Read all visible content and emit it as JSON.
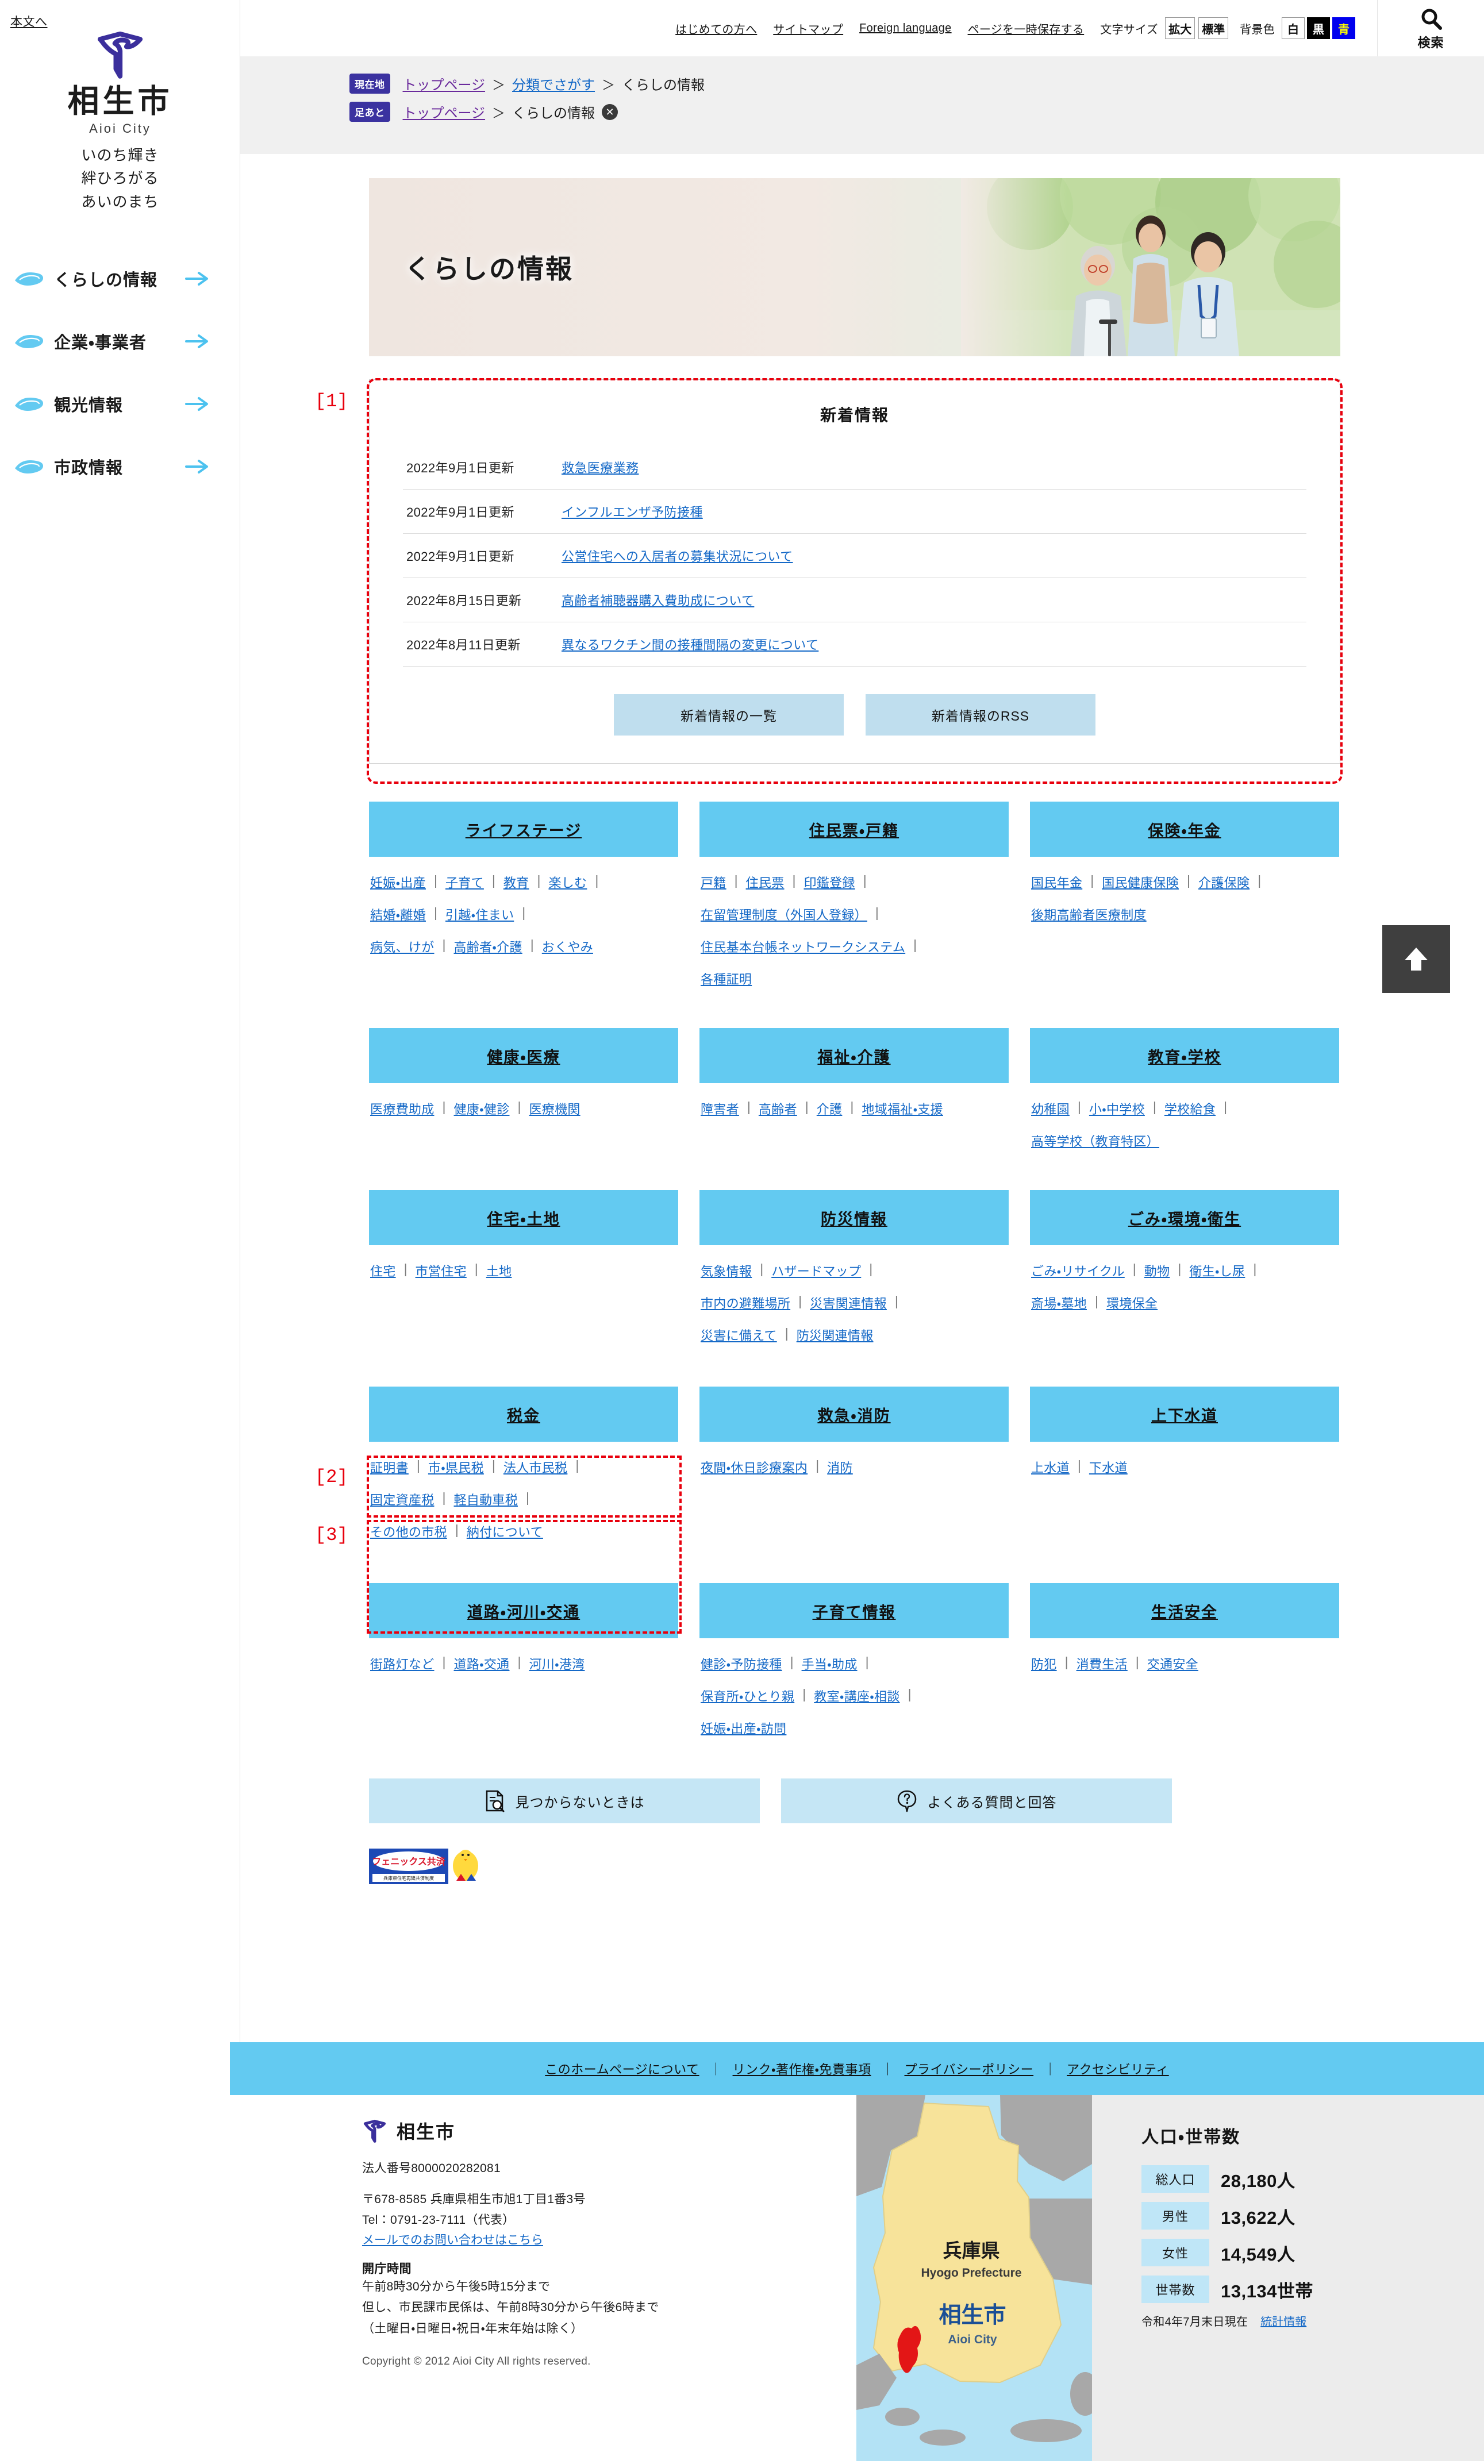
{
  "skip_link": "本文へ",
  "brand": {
    "name_jp": "相生市",
    "name_en": "Aioi City",
    "slogan": [
      "いのち輝き",
      "絆ひろがる",
      "あいのまち"
    ]
  },
  "utility": {
    "links": [
      "はじめての方へ",
      "サイトマップ",
      "Foreign language",
      "ページを一時保存する"
    ],
    "text_size_label": "文字サイズ",
    "text_size_options": [
      "拡大",
      "標準"
    ],
    "bg_color_label": "背景色",
    "bg_color_options": [
      "白",
      "黒",
      "青"
    ],
    "search_label": "検索"
  },
  "breadcrumbs": {
    "current_badge": "現在地",
    "current_items": [
      "トップページ",
      "分類でさがす",
      "くらしの情報"
    ],
    "history_badge": "足あと",
    "history_items": [
      "トップページ",
      "くらしの情報"
    ],
    "close": "✕",
    "separator": "＞"
  },
  "sidebar": {
    "items": [
      {
        "label": "くらしの情報"
      },
      {
        "label": "企業・事業者"
      },
      {
        "label": "観光情報"
      },
      {
        "label": "市政情報"
      }
    ]
  },
  "hero": {
    "title": "くらしの情報"
  },
  "news": {
    "heading": "新着情報",
    "items": [
      {
        "date": "2022年9月1日更新",
        "title": "救急医療業務"
      },
      {
        "date": "2022年9月1日更新",
        "title": "インフルエンザ予防接種"
      },
      {
        "date": "2022年9月1日更新",
        "title": "公営住宅への入居者の募集状況について"
      },
      {
        "date": "2022年8月15日更新",
        "title": "高齢者補聴器購入費助成について"
      },
      {
        "date": "2022年8月11日更新",
        "title": "異なるワクチン間の接種間隔の変更について"
      }
    ],
    "buttons": [
      "新着情報の一覧",
      "新着情報のRSS"
    ]
  },
  "categories": [
    {
      "title": "ライフステージ",
      "links": [
        "妊娠・出産",
        "子育て",
        "教育",
        "楽しむ",
        "結婚・離婚",
        "引越・住まい",
        "病気、けが",
        "高齢者・介護",
        "おくやみ"
      ]
    },
    {
      "title": "住民票・戸籍",
      "links": [
        "戸籍",
        "住民票",
        "印鑑登録",
        "在留管理制度（外国人登録）",
        "住民基本台帳ネットワークシステム",
        "各種証明"
      ]
    },
    {
      "title": "保険・年金",
      "links": [
        "国民年金",
        "国民健康保険",
        "介護保険",
        "後期高齢者医療制度"
      ]
    },
    {
      "title": "健康・医療",
      "links": [
        "医療費助成",
        "健康・健診",
        "医療機関"
      ]
    },
    {
      "title": "福祉・介護",
      "links": [
        "障害者",
        "高齢者",
        "介護",
        "地域福祉・支援"
      ]
    },
    {
      "title": "教育・学校",
      "links": [
        "幼稚園",
        "小・中学校",
        "学校給食",
        "高等学校（教育特区）"
      ]
    },
    {
      "title": "住宅・土地",
      "links": [
        "住宅",
        "市営住宅",
        "土地"
      ]
    },
    {
      "title": "防災情報",
      "links": [
        "気象情報",
        "ハザードマップ",
        "市内の避難場所",
        "災害関連情報",
        "災害に備えて",
        "防災関連情報"
      ]
    },
    {
      "title": "ごみ・環境・衛生",
      "links": [
        "ごみ・リサイクル",
        "動物",
        "衛生・し尿",
        "斎場・墓地",
        "環境保全"
      ]
    },
    {
      "title": "税金",
      "links": [
        "証明書",
        "市・県民税",
        "法人市民税",
        "固定資産税",
        "軽自動車税",
        "その他の市税",
        "納付について"
      ]
    },
    {
      "title": "救急・消防",
      "links": [
        "夜間・休日診療案内",
        "消防"
      ]
    },
    {
      "title": "上下水道",
      "links": [
        "上水道",
        "下水道"
      ]
    },
    {
      "title": "道路・河川・交通",
      "links": [
        "街路灯など",
        "道路・交通",
        "河川・港湾"
      ]
    },
    {
      "title": "子育て情報",
      "links": [
        "健診・予防接種",
        "手当・助成",
        "保育所・ひとり親",
        "教室・講座・相談",
        "妊娠・出産・訪問"
      ]
    },
    {
      "title": "生活安全",
      "links": [
        "防犯",
        "消費生活",
        "交通安全"
      ]
    }
  ],
  "help_buttons": [
    {
      "label": "見つからないときは",
      "icon": "document-search-icon"
    },
    {
      "label": "よくある質問と回答",
      "icon": "question-balloon-icon"
    }
  ],
  "phoenix_banner": {
    "title": "フェニックス共済",
    "subtitle": "兵庫県住宅再建共済制度"
  },
  "footer": {
    "links": [
      "このホームページについて",
      "リンク・著作権・免責事項",
      "プライバシーポリシー",
      "アクセシビリティ"
    ],
    "link_separator": "｜",
    "city": "相生市",
    "corporate_number": "法人番号8000020282081",
    "address": "〒678-8585 兵庫県相生市旭1丁目1番3号",
    "tel": "Tel：0791-23-7111（代表）",
    "mail_link": "メールでのお問い合わせはこちら",
    "hours_heading": "開庁時間",
    "hours_lines": [
      "午前8時30分から午後5時15分まで",
      "但し、市民課市民係は、午前8時30分から午後6時まで",
      "（土曜日・日曜日・祝日・年末年始は除く）"
    ],
    "copyright": "Copyright © 2012 Aioi City All rights reserved."
  },
  "map": {
    "prefecture_jp": "兵庫県",
    "prefecture_en": "Hyogo Prefecture",
    "city_jp": "相生市",
    "city_en": "Aioi City"
  },
  "stats": {
    "title": "人口・世帯数",
    "rows": [
      {
        "label": "総人口",
        "value": "28,180人"
      },
      {
        "label": "男性",
        "value": "13,622人"
      },
      {
        "label": "女性",
        "value": "14,549人"
      },
      {
        "label": "世帯数",
        "value": "13,134世帯"
      }
    ],
    "as_of": "令和4年7月末日現在",
    "link": "統計情報"
  },
  "annotations": [
    {
      "id": "1",
      "tag": "[1]"
    },
    {
      "id": "2",
      "tag": "[2]"
    },
    {
      "id": "3",
      "tag": "[3]"
    }
  ],
  "colors": {
    "brand_blue": "#63caf1",
    "link_blue": "#1569c7",
    "crest_purple": "#3b2f9c",
    "annotation_red": "#e8000d"
  }
}
